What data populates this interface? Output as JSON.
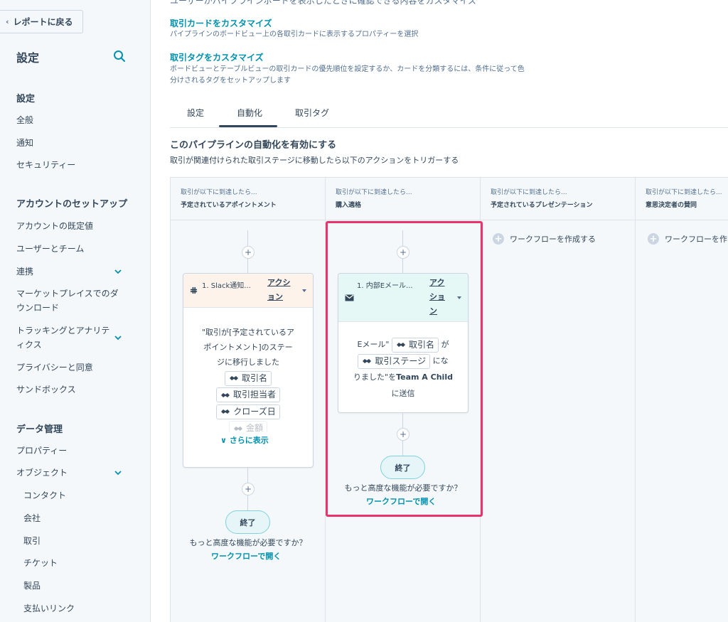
{
  "sidebar": {
    "back_label": "レポートに戻る",
    "title": "設定",
    "sections": [
      {
        "label": "設定"
      },
      {
        "label": "アカウントのセットアップ"
      },
      {
        "label": "データ管理"
      }
    ],
    "items": {
      "general": "全般",
      "notifications": "通知",
      "security": "セキュリティー",
      "account_defaults": "アカウントの既定値",
      "users_teams": "ユーザーとチーム",
      "integrations": "連携",
      "marketplace": "マーケットプレイスでのダウンロード",
      "tracking": "トラッキングとアナリティクス",
      "privacy": "プライバシーと同意",
      "sandbox": "サンドボックス",
      "properties": "プロパティー",
      "objects": "オブジェクト",
      "contacts": "コンタクト",
      "companies": "会社",
      "deals": "取引",
      "tickets": "チケット",
      "products": "製品",
      "payment_links": "支払いリンク"
    }
  },
  "main": {
    "top_cut_text": "ユーザーがパイプラインボードを表示したときに確認できる内容をカスタマイズ",
    "customize_cards": {
      "title": "取引カードをカスタマイズ",
      "desc": "パイプラインのボードビュー上の各取引カードに表示するプロパティーを選択"
    },
    "customize_tags": {
      "title": "取引タグをカスタマイズ",
      "desc_line1": "ボードビューとテーブルビューの取引カードの優先順位を設定するか、カードを分類するには、条件に従って色",
      "desc_line2": "分けされるタグをセットアップします"
    },
    "tabs": [
      "設定",
      "自動化",
      "取引タグ"
    ],
    "automation_heading": "このパイプラインの自動化を有効にする",
    "automation_sub": "取引が関連付けられた取引ステージに移動したら以下のアクションをトリガーする"
  },
  "board": {
    "columns": [
      {
        "pre": "取引が以下に到達したら...",
        "stage": "予定されているアポイントメント"
      },
      {
        "pre": "取引が以下に到達したら...",
        "stage": "購入適格"
      },
      {
        "pre": "取引が以下に到達したら...",
        "stage": "予定されているプレゼンテーション"
      },
      {
        "pre": "取引が以下に到達したら...",
        "stage": "意思決定者の賛同"
      }
    ],
    "card1": {
      "title": "1. Slack通知...",
      "action_line1": "アクシ",
      "action_line2": "ョン",
      "body_line1": "\"取引が[予定されているア",
      "body_line2": "ポイントメント]のステー",
      "body_line3": "ジに移行しました",
      "token1": "取引名",
      "token2": "取引担当者",
      "token3": "クローズ日",
      "token4": "金額",
      "show_more": "さらに表示"
    },
    "card2": {
      "title": "1. 内部Eメール...",
      "action_line1": "アク",
      "action_line2": "ショ",
      "action_line3": "ン",
      "body_pre": "Eメール\"",
      "token1": "取引名",
      "body_ga": "が",
      "token2": "取引ステージ",
      "body_nari": "にな",
      "body_line3_a": "りました\"を",
      "body_line3_b": "Team A Child",
      "body_line4": "に送信"
    },
    "end_label": "終了",
    "advanced_text": "もっと高度な機能が必要ですか？",
    "open_workflow": "ワークフローで開く",
    "create_workflow": "ワークフローを作成する",
    "create_workflow_cut": "ワークフローを作"
  },
  "colors": {
    "accent_link": "#0091ae",
    "highlight": "#e8336b",
    "slack_head": "#fdf3ea",
    "email_head": "#e5f8f6"
  }
}
